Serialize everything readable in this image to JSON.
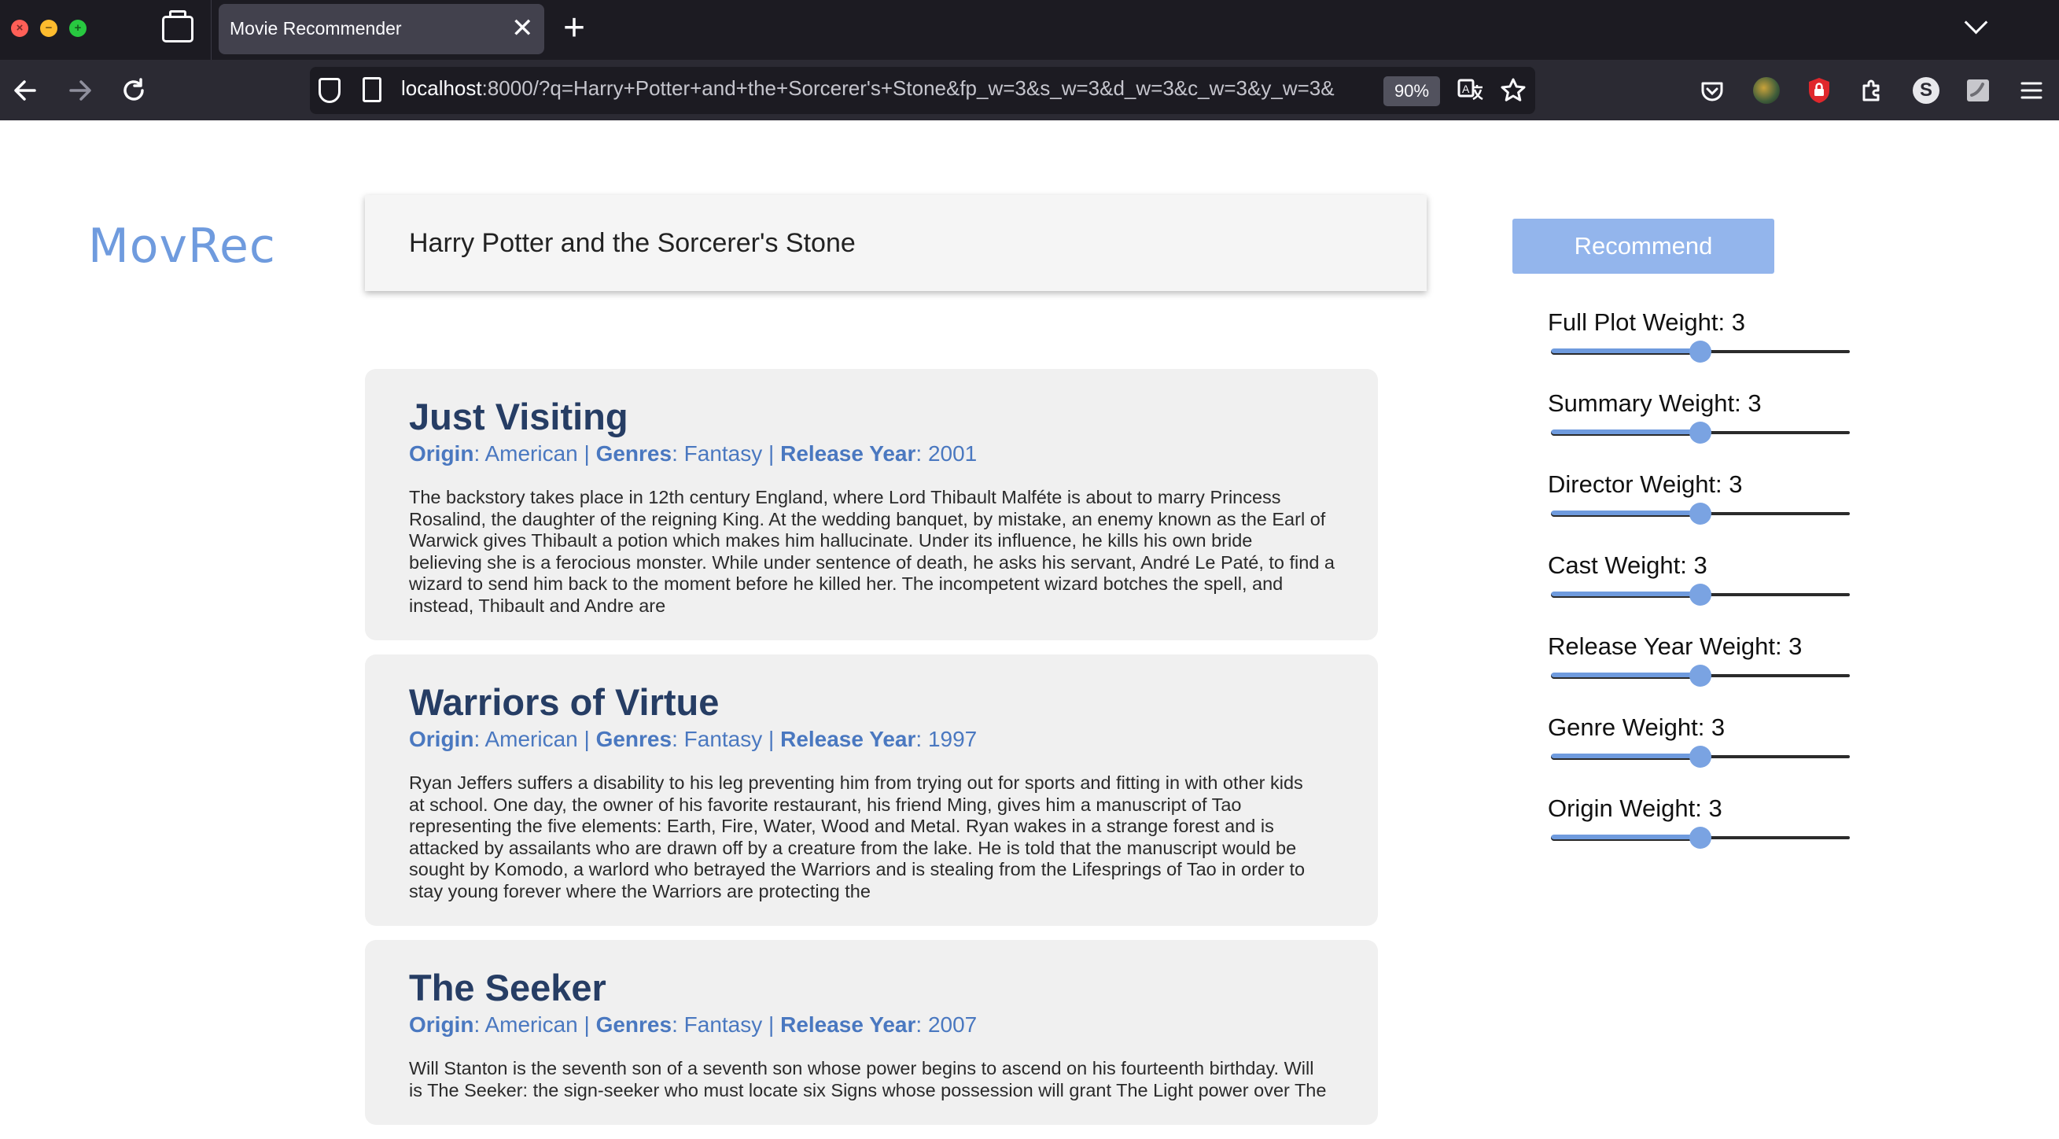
{
  "browser": {
    "tab_title": "Movie Recommender",
    "tab_close_glyph": "✕",
    "new_tab_glyph": "+",
    "url_host": "localhost",
    "url_rest": ":8000/?q=Harry+Potter+and+the+Sorcerer's+Stone&fp_w=3&s_w=3&d_w=3&c_w=3&y_w=3&",
    "zoom": "90%",
    "nav_icons": [
      "back-arrow-icon",
      "forward-arrow-icon",
      "reload-icon"
    ],
    "right_icons": [
      "pocket-icon",
      "extension-avatar-icon",
      "ublock-icon",
      "extensions-icon",
      "profile-s-icon",
      "extension-icon",
      "menu-icon"
    ]
  },
  "app": {
    "brand": "MovRec",
    "search_value": "Harry Potter and the Sorcerer's Stone",
    "recommend_label": "Recommend",
    "accent_color": "#6f9bde",
    "weights": [
      {
        "label": "Full Plot Weight: 3",
        "value": 3,
        "max": 6
      },
      {
        "label": "Summary Weight: 3",
        "value": 3,
        "max": 6
      },
      {
        "label": "Director Weight: 3",
        "value": 3,
        "max": 6
      },
      {
        "label": "Cast Weight: 3",
        "value": 3,
        "max": 6
      },
      {
        "label": "Release Year Weight: 3",
        "value": 3,
        "max": 6
      },
      {
        "label": "Genre Weight: 3",
        "value": 3,
        "max": 6
      },
      {
        "label": "Origin Weight: 3",
        "value": 3,
        "max": 6
      }
    ]
  },
  "meta_labels": {
    "origin": "Origin",
    "genres": "Genres",
    "year": "Release Year",
    "colon": ": ",
    "sep": " | "
  },
  "results": [
    {
      "title": "Just Visiting",
      "origin": "American",
      "genres": "Fantasy",
      "year": "2001",
      "plot_lines": [
        "The backstory takes place in 12th century England, where Lord Thibault Malféte is about to marry Princess",
        "Rosalind, the daughter of the reigning King. At the wedding banquet, by mistake, an enemy known as the Earl of",
        "Warwick gives Thibault a potion which makes him hallucinate. Under its influence, he kills his own bride",
        "believing she is a ferocious monster. While under sentence of death, he asks his servant, André Le Paté, to find a",
        "wizard to send him back to the moment before he killed her. The incompetent wizard botches the spell, and",
        "instead, Thibault and Andre are"
      ]
    },
    {
      "title": "Warriors of Virtue",
      "origin": "American",
      "genres": "Fantasy",
      "year": "1997",
      "plot_lines": [
        "Ryan Jeffers suffers a disability to his leg preventing him from trying out for sports and fitting in with other kids",
        "at school. One day, the owner of his favorite restaurant, his friend Ming, gives him a manuscript of Tao",
        "representing the five elements: Earth, Fire, Water, Wood and Metal. Ryan wakes in a strange forest and is",
        "attacked by assailants who are drawn off by a creature from the lake. He is told that the manuscript would be",
        "sought by Komodo, a warlord who betrayed the Warriors and is stealing from the Lifesprings of Tao in order to",
        "stay young forever where the Warriors are protecting the"
      ]
    },
    {
      "title": "The Seeker",
      "origin": "American",
      "genres": "Fantasy",
      "year": "2007",
      "plot_lines": [
        "Will Stanton is the seventh son of a seventh son whose power begins to ascend on his fourteenth birthday. Will",
        "is The Seeker: the sign-seeker who must locate six Signs whose possession will grant The Light power over The"
      ]
    }
  ]
}
